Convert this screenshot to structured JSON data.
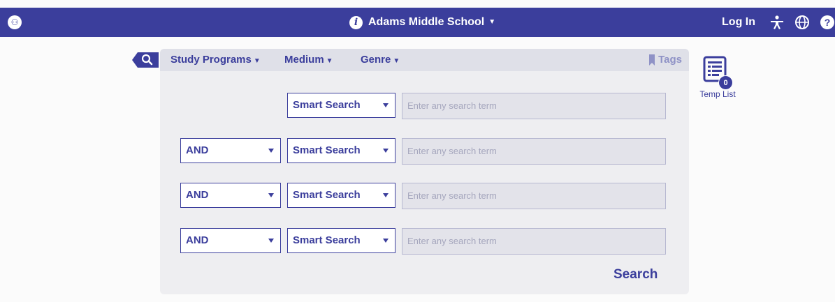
{
  "header": {
    "logo": "person-logo",
    "school_name": "Adams Middle School",
    "login_label": "Log In",
    "icons": [
      "accessibility-icon",
      "globe-icon",
      "help-icon"
    ]
  },
  "filters": {
    "study_programs": "Study Programs",
    "medium": "Medium",
    "genre": "Genre",
    "tags": "Tags"
  },
  "search_rows": [
    {
      "operator": null,
      "field": "Smart Search",
      "placeholder": "Enter any search term"
    },
    {
      "operator": "AND",
      "field": "Smart Search",
      "placeholder": "Enter any search term"
    },
    {
      "operator": "AND",
      "field": "Smart Search",
      "placeholder": "Enter any search term"
    },
    {
      "operator": "AND",
      "field": "Smart Search",
      "placeholder": "Enter any search term"
    }
  ],
  "search_button": "Search",
  "temp_list": {
    "label": "Temp List",
    "count": "0"
  },
  "colors": {
    "brand": "#3b3e9c",
    "panel": "#eeeef1",
    "input_bg": "#e3e3ea"
  }
}
